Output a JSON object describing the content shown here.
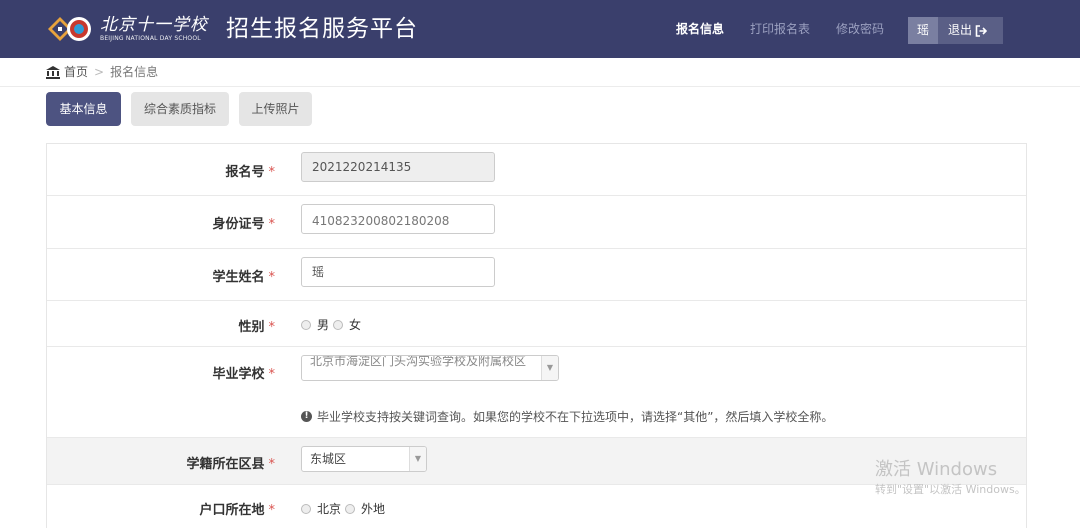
{
  "header": {
    "logo_cn": "北京十一学校",
    "logo_en": "BEIJING NATIONAL DAY SCHOOL",
    "title": "招生报名服务平台",
    "nav": {
      "baoming": "报名信息",
      "print": "打印报名表",
      "password": "修改密码"
    },
    "user_name": "瑶",
    "logout": "退出"
  },
  "breadcrumb": {
    "home": "首页",
    "separator": ">",
    "current": "报名信息"
  },
  "tabs": {
    "basic": "基本信息",
    "quality": "综合素质指标",
    "photo": "上传照片"
  },
  "form": {
    "required_mark": "*",
    "reg_no": {
      "label": "报名号",
      "value": "2021220214135"
    },
    "id_no": {
      "label": "身份证号",
      "value": "410823200802180208"
    },
    "name": {
      "label": "学生姓名",
      "value": "瑶"
    },
    "gender": {
      "label": "性别",
      "opt1": "男",
      "opt2": "女"
    },
    "school": {
      "label": "毕业学校",
      "value": "北京市海淀区门头沟实验学校及附属校区"
    },
    "school_hint": "毕业学校支持按关键词查询。如果您的学校不在下拉选项中，请选择“其他”，然后填入学校全称。",
    "district": {
      "label": "学籍所在区县",
      "value": "东城区"
    },
    "hukou": {
      "label": "户口所在地",
      "opt1": "北京",
      "opt2": "外地"
    }
  },
  "watermark": {
    "title": "激活 Windows",
    "sub": "转到\"设置\"以激活 Windows。"
  },
  "colors": {
    "header_bg": "#3a3f6c",
    "active_tab": "#4d5381",
    "required": "#d9534f"
  }
}
